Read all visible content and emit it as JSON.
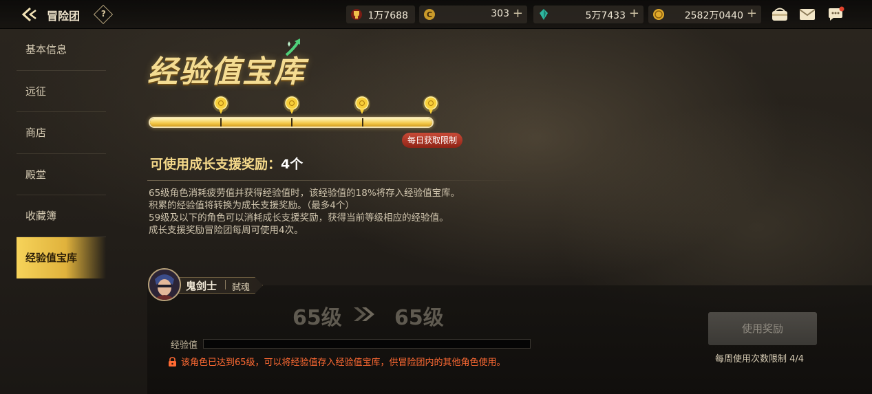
{
  "header": {
    "title": "冒险团",
    "help": "?",
    "currencies": [
      {
        "icon": "trophy-icon",
        "value": "1万7688",
        "plus": ""
      },
      {
        "icon": "coin-c-icon",
        "value": "303",
        "plus": "+"
      },
      {
        "icon": "gem-icon",
        "value": "5万7433",
        "plus": "+"
      },
      {
        "icon": "gold-icon",
        "value": "2582万0440",
        "plus": "+"
      }
    ],
    "icons": [
      "wallet-icon",
      "mail-icon",
      "chat-icon"
    ]
  },
  "sidebar": {
    "items": [
      {
        "label": "基本信息"
      },
      {
        "label": "远征"
      },
      {
        "label": "商店"
      },
      {
        "label": "殿堂"
      },
      {
        "label": "收藏簿"
      },
      {
        "label": "经验值宝库",
        "active": true
      }
    ]
  },
  "vault": {
    "title": "经验值宝库",
    "progress": {
      "current": 4,
      "max": 4
    },
    "limit_badge": "每日获取限制",
    "reward_label": "可使用成长支援奖励：",
    "reward_count": "4个",
    "desc": [
      "65级角色消耗疲劳值并获得经验值时，该经验值的18%将存入经验值宝库。",
      "积累的经验值将转换为成长支援奖励。（最多4个）",
      "59级及以下的角色可以消耗成长支援奖励，获得当前等级相应的经验值。",
      "成长支援奖励冒险团每周可使用4次。"
    ]
  },
  "character": {
    "name": "鬼剑士",
    "class": "弑魂",
    "level_from": "65级",
    "level_to": "65级",
    "exp_label": "经验值",
    "exp_fraction": 0,
    "warning": "该角色已达到65级，可以将经验值存入经验值宝库，供冒险团内的其他角色使用。",
    "use_button": "使用奖励",
    "weekly_limit": "每周使用次数限制 4/4"
  }
}
